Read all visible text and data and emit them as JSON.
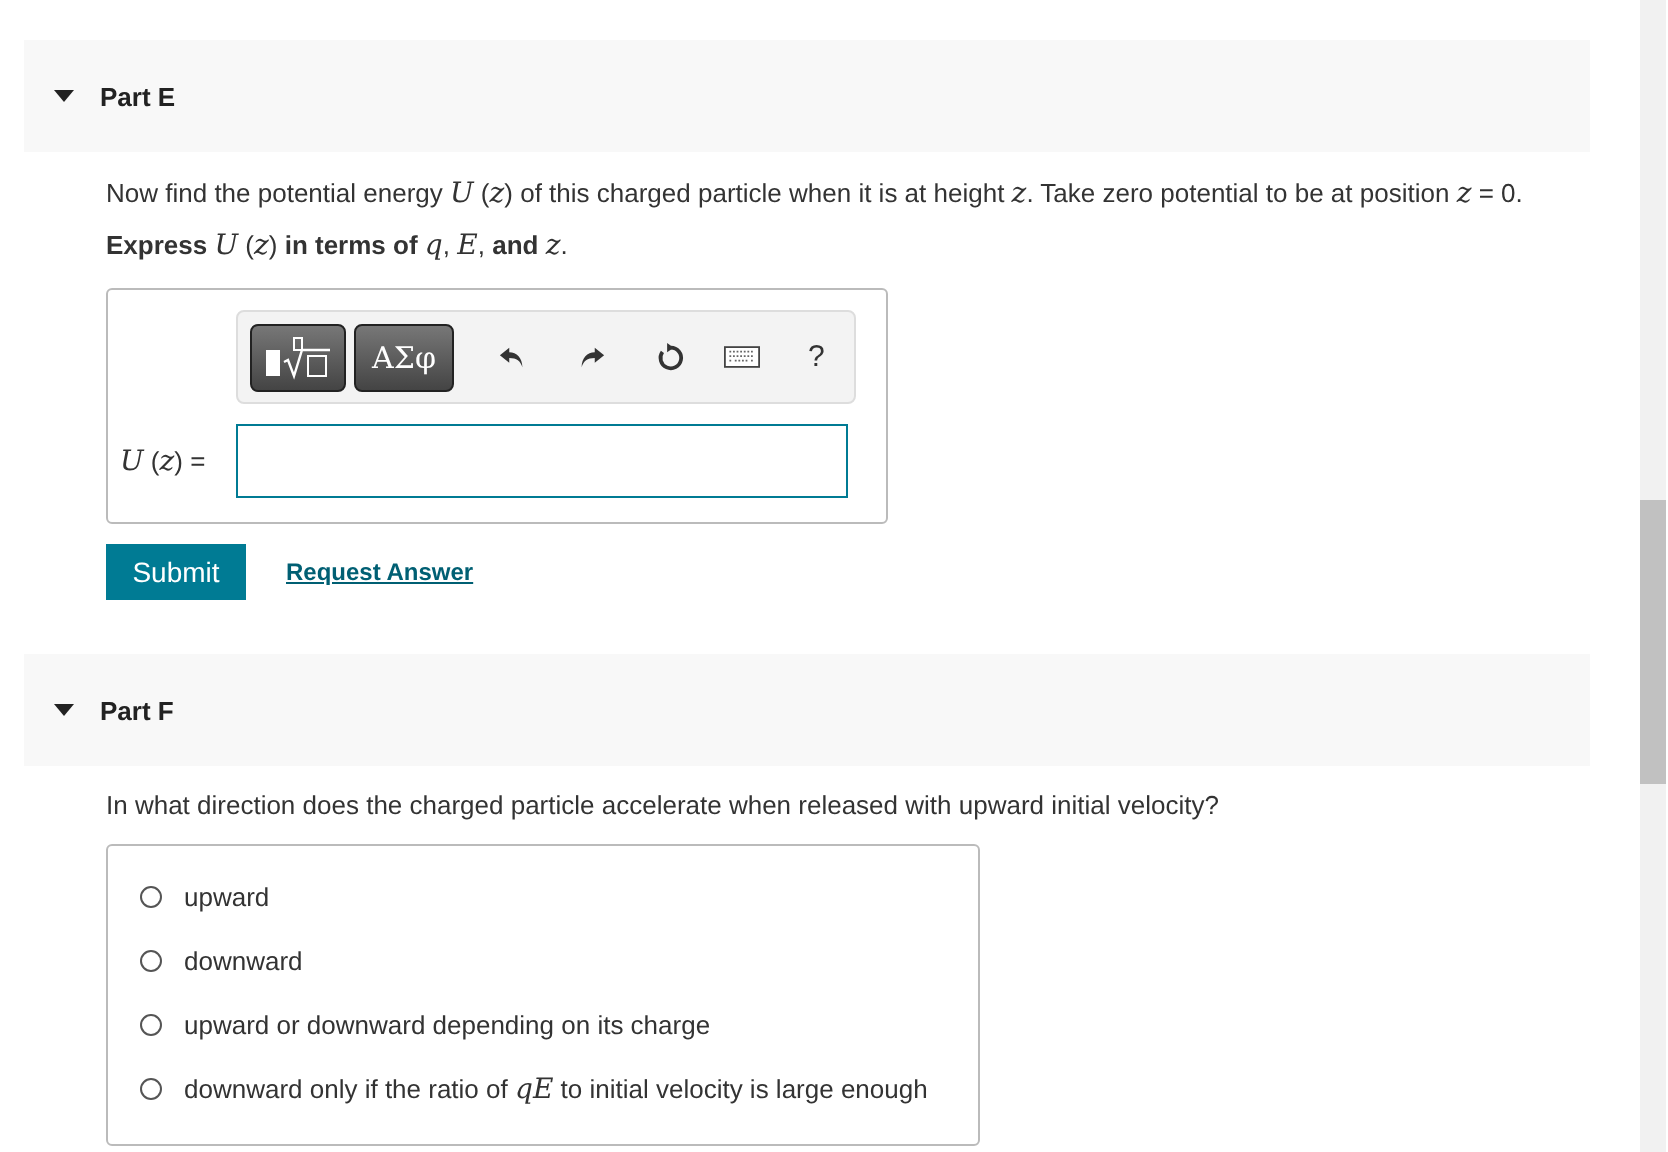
{
  "parts": [
    {
      "kind": "expression",
      "title": "Part E",
      "expanded": true,
      "prompt": "Now find the potential energy *U* (*z*) of this charged particle when it is at height *z*. Take zero potential to be at position *z* = 0.",
      "instruction": "**Express** *U* (*z*) **in terms of** *q*, *E*, **and** *z*.",
      "toolbar": {
        "symbols_label": "ΑΣφ",
        "help_label": "?"
      },
      "answer_label": "*U* (*z*) =",
      "buttons": {
        "submit": "Submit",
        "request": "Request Answer"
      }
    },
    {
      "kind": "choice",
      "title": "Part F",
      "expanded": true,
      "prompt": "In what direction does the charged particle accelerate when released with upward initial velocity?",
      "options": [
        {
          "label": "upward",
          "selected": false
        },
        {
          "label": "downward",
          "selected": false
        },
        {
          "label": "upward or downward depending on its charge",
          "selected": false
        },
        {
          "label": "downward only if the ratio of *qE* to initial velocity is large enough",
          "selected": false
        }
      ]
    }
  ]
}
